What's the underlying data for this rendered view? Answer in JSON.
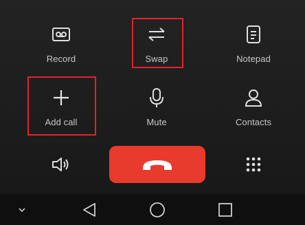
{
  "actions": {
    "record": {
      "label": "Record",
      "icon": "record-icon"
    },
    "swap": {
      "label": "Swap",
      "icon": "swap-icon"
    },
    "notepad": {
      "label": "Notepad",
      "icon": "notepad-icon"
    },
    "add_call": {
      "label": "Add call",
      "icon": "plus-icon"
    },
    "mute": {
      "label": "Mute",
      "icon": "microphone-icon"
    },
    "contacts": {
      "label": "Contacts",
      "icon": "person-icon"
    }
  },
  "bottom_controls": {
    "speaker": {
      "icon": "speaker-icon"
    },
    "end_call": {
      "icon": "phone-hangup-icon",
      "color": "#e83a2d"
    },
    "dialpad": {
      "icon": "dialpad-icon"
    }
  },
  "navbar": {
    "items": [
      "chevron-down-icon",
      "back-triangle-icon",
      "home-circle-icon",
      "recents-square-icon"
    ]
  },
  "colors": {
    "highlight": "#e0242b",
    "background": "#1b1b1b",
    "end_call": "#e83a2d"
  }
}
